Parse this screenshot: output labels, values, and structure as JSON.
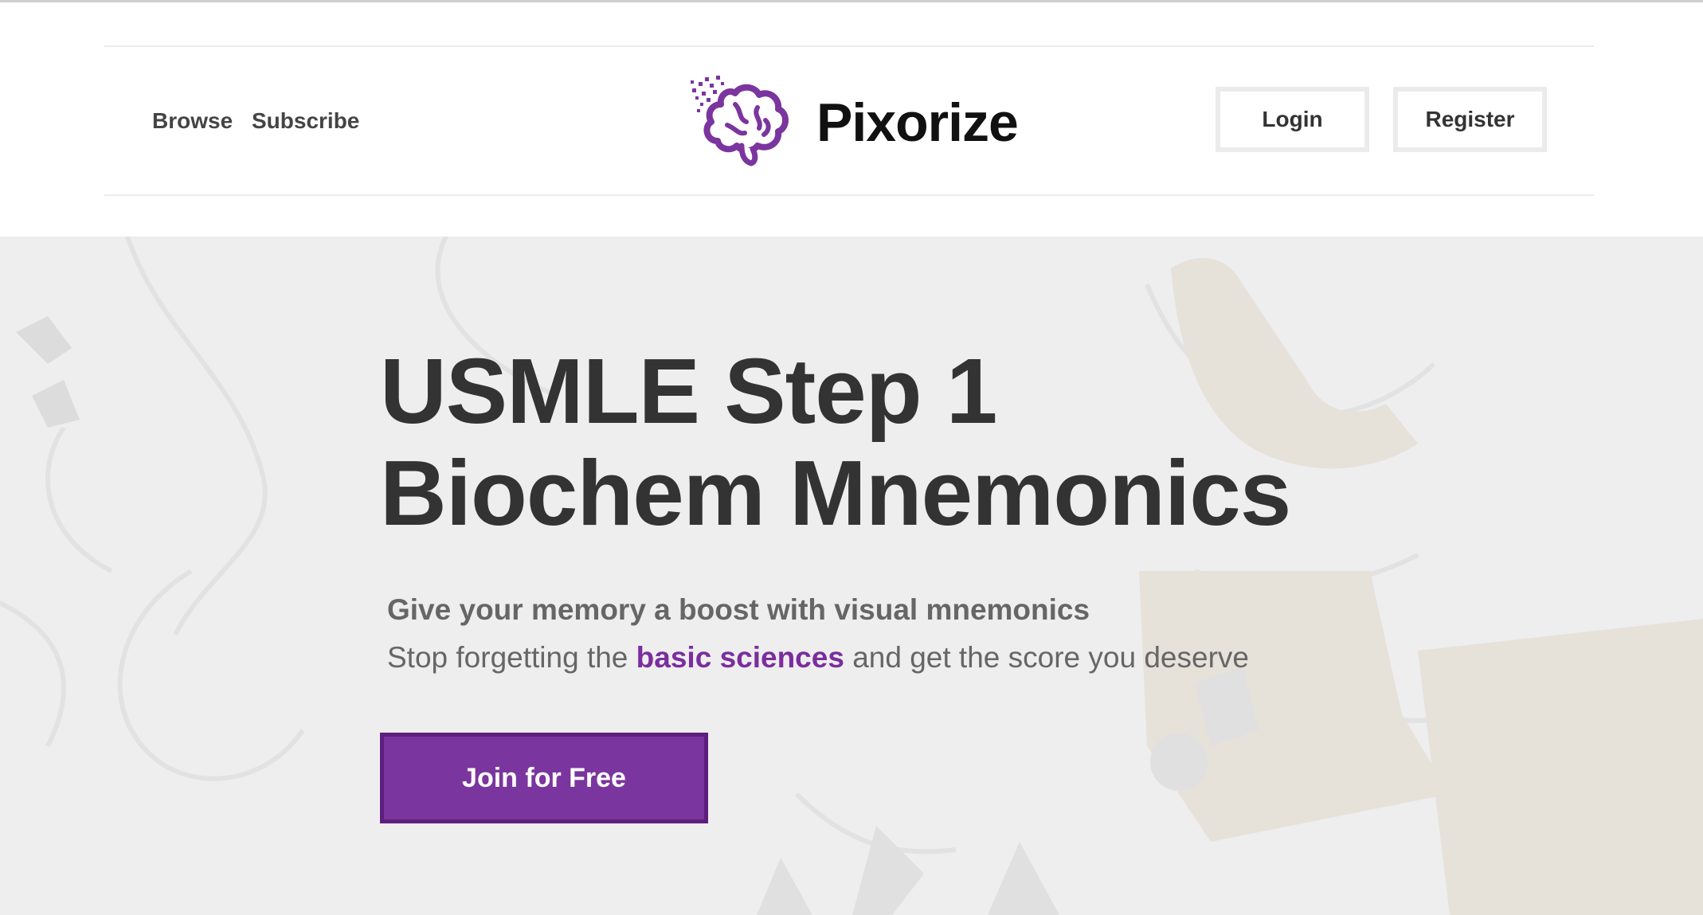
{
  "nav": {
    "browse": "Browse",
    "subscribe": "Subscribe"
  },
  "brand": {
    "name": "Pixorize",
    "color": "#7b359e"
  },
  "auth": {
    "login": "Login",
    "register": "Register"
  },
  "hero": {
    "title_line1": "USMLE Step 1",
    "title_line2": "Biochem Mnemonics",
    "subtitle": "Give your memory a boost with visual mnemonics",
    "tagline_before": "Stop forgetting the ",
    "tagline_link": "basic sciences",
    "tagline_after": " and get the score you deserve",
    "cta": "Join for Free"
  },
  "icons": {
    "logo": "brain-icon"
  }
}
